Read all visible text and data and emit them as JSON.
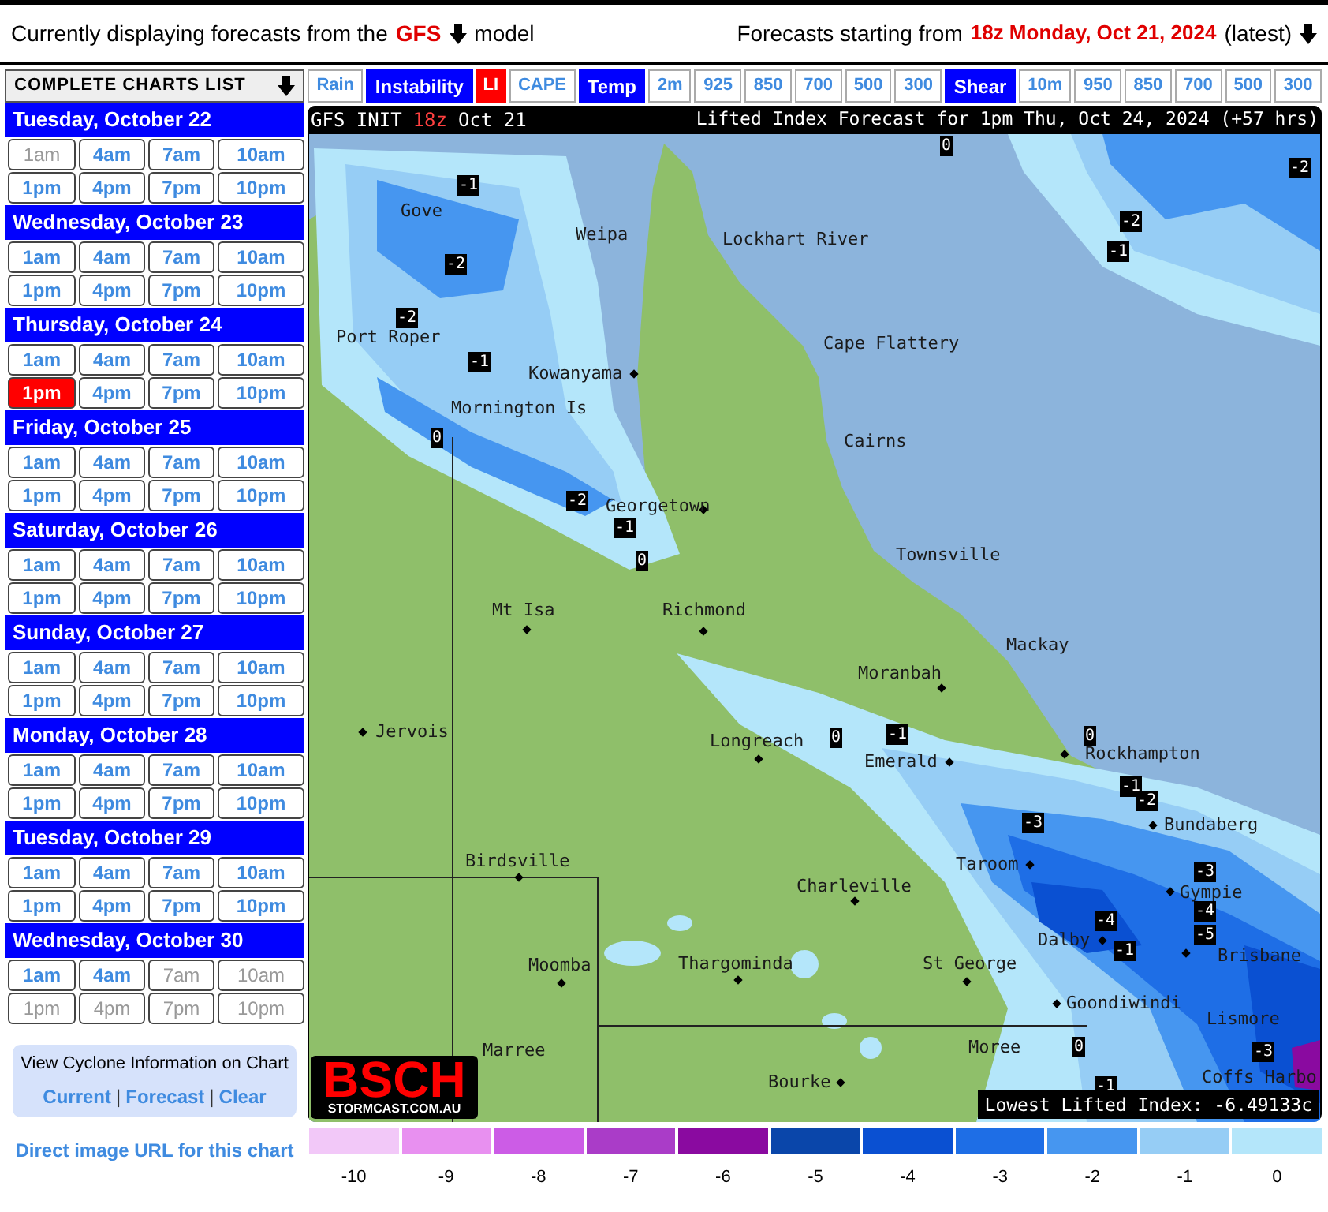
{
  "header": {
    "model_prefix": "Currently displaying forecasts from the",
    "model": "GFS",
    "model_suffix": "model",
    "run_prefix": "Forecasts starting from",
    "run": "18z Monday, Oct 21, 2024",
    "run_suffix": "(latest)"
  },
  "sidebar": {
    "title": "COMPLETE CHARTS LIST",
    "days": [
      {
        "label": "Tuesday, October 22",
        "times": [
          {
            "label": "1am",
            "selected": false,
            "disabled": true
          },
          {
            "label": "4am",
            "selected": false,
            "disabled": false
          },
          {
            "label": "7am",
            "selected": false,
            "disabled": false
          },
          {
            "label": "10am",
            "selected": false,
            "disabled": false
          },
          {
            "label": "1pm",
            "selected": false,
            "disabled": false
          },
          {
            "label": "4pm",
            "selected": false,
            "disabled": false
          },
          {
            "label": "7pm",
            "selected": false,
            "disabled": false
          },
          {
            "label": "10pm",
            "selected": false,
            "disabled": false
          }
        ]
      },
      {
        "label": "Wednesday, October 23",
        "times": [
          {
            "label": "1am",
            "selected": false,
            "disabled": false
          },
          {
            "label": "4am",
            "selected": false,
            "disabled": false
          },
          {
            "label": "7am",
            "selected": false,
            "disabled": false
          },
          {
            "label": "10am",
            "selected": false,
            "disabled": false
          },
          {
            "label": "1pm",
            "selected": false,
            "disabled": false
          },
          {
            "label": "4pm",
            "selected": false,
            "disabled": false
          },
          {
            "label": "7pm",
            "selected": false,
            "disabled": false
          },
          {
            "label": "10pm",
            "selected": false,
            "disabled": false
          }
        ]
      },
      {
        "label": "Thursday, October 24",
        "times": [
          {
            "label": "1am",
            "selected": false,
            "disabled": false
          },
          {
            "label": "4am",
            "selected": false,
            "disabled": false
          },
          {
            "label": "7am",
            "selected": false,
            "disabled": false
          },
          {
            "label": "10am",
            "selected": false,
            "disabled": false
          },
          {
            "label": "1pm",
            "selected": true,
            "disabled": false
          },
          {
            "label": "4pm",
            "selected": false,
            "disabled": false
          },
          {
            "label": "7pm",
            "selected": false,
            "disabled": false
          },
          {
            "label": "10pm",
            "selected": false,
            "disabled": false
          }
        ]
      },
      {
        "label": "Friday, October 25",
        "times": [
          {
            "label": "1am",
            "selected": false,
            "disabled": false
          },
          {
            "label": "4am",
            "selected": false,
            "disabled": false
          },
          {
            "label": "7am",
            "selected": false,
            "disabled": false
          },
          {
            "label": "10am",
            "selected": false,
            "disabled": false
          },
          {
            "label": "1pm",
            "selected": false,
            "disabled": false
          },
          {
            "label": "4pm",
            "selected": false,
            "disabled": false
          },
          {
            "label": "7pm",
            "selected": false,
            "disabled": false
          },
          {
            "label": "10pm",
            "selected": false,
            "disabled": false
          }
        ]
      },
      {
        "label": "Saturday, October 26",
        "times": [
          {
            "label": "1am",
            "selected": false,
            "disabled": false
          },
          {
            "label": "4am",
            "selected": false,
            "disabled": false
          },
          {
            "label": "7am",
            "selected": false,
            "disabled": false
          },
          {
            "label": "10am",
            "selected": false,
            "disabled": false
          },
          {
            "label": "1pm",
            "selected": false,
            "disabled": false
          },
          {
            "label": "4pm",
            "selected": false,
            "disabled": false
          },
          {
            "label": "7pm",
            "selected": false,
            "disabled": false
          },
          {
            "label": "10pm",
            "selected": false,
            "disabled": false
          }
        ]
      },
      {
        "label": "Sunday, October 27",
        "times": [
          {
            "label": "1am",
            "selected": false,
            "disabled": false
          },
          {
            "label": "4am",
            "selected": false,
            "disabled": false
          },
          {
            "label": "7am",
            "selected": false,
            "disabled": false
          },
          {
            "label": "10am",
            "selected": false,
            "disabled": false
          },
          {
            "label": "1pm",
            "selected": false,
            "disabled": false
          },
          {
            "label": "4pm",
            "selected": false,
            "disabled": false
          },
          {
            "label": "7pm",
            "selected": false,
            "disabled": false
          },
          {
            "label": "10pm",
            "selected": false,
            "disabled": false
          }
        ]
      },
      {
        "label": "Monday, October 28",
        "times": [
          {
            "label": "1am",
            "selected": false,
            "disabled": false
          },
          {
            "label": "4am",
            "selected": false,
            "disabled": false
          },
          {
            "label": "7am",
            "selected": false,
            "disabled": false
          },
          {
            "label": "10am",
            "selected": false,
            "disabled": false
          },
          {
            "label": "1pm",
            "selected": false,
            "disabled": false
          },
          {
            "label": "4pm",
            "selected": false,
            "disabled": false
          },
          {
            "label": "7pm",
            "selected": false,
            "disabled": false
          },
          {
            "label": "10pm",
            "selected": false,
            "disabled": false
          }
        ]
      },
      {
        "label": "Tuesday, October 29",
        "times": [
          {
            "label": "1am",
            "selected": false,
            "disabled": false
          },
          {
            "label": "4am",
            "selected": false,
            "disabled": false
          },
          {
            "label": "7am",
            "selected": false,
            "disabled": false
          },
          {
            "label": "10am",
            "selected": false,
            "disabled": false
          },
          {
            "label": "1pm",
            "selected": false,
            "disabled": false
          },
          {
            "label": "4pm",
            "selected": false,
            "disabled": false
          },
          {
            "label": "7pm",
            "selected": false,
            "disabled": false
          },
          {
            "label": "10pm",
            "selected": false,
            "disabled": false
          }
        ]
      },
      {
        "label": "Wednesday, October 30",
        "times": [
          {
            "label": "1am",
            "selected": false,
            "disabled": false
          },
          {
            "label": "4am",
            "selected": false,
            "disabled": false
          },
          {
            "label": "7am",
            "selected": false,
            "disabled": true
          },
          {
            "label": "10am",
            "selected": false,
            "disabled": true
          },
          {
            "label": "1pm",
            "selected": false,
            "disabled": true
          },
          {
            "label": "4pm",
            "selected": false,
            "disabled": true
          },
          {
            "label": "7pm",
            "selected": false,
            "disabled": true
          },
          {
            "label": "10pm",
            "selected": false,
            "disabled": true
          }
        ]
      }
    ],
    "cyclone": {
      "title": "View Cyclone Information on Chart",
      "links": [
        {
          "kind": "link",
          "label": "Current"
        },
        {
          "kind": "separator",
          "label": "|"
        },
        {
          "kind": "link",
          "label": "Forecast"
        },
        {
          "kind": "separator",
          "label": "|"
        },
        {
          "kind": "link",
          "label": "Clear"
        }
      ]
    },
    "direct_link": "Direct image URL for this chart"
  },
  "chart_tabs": [
    {
      "label": "Rain",
      "kind": "option",
      "selected": false
    },
    {
      "label": "Instability",
      "kind": "group"
    },
    {
      "label": "LI",
      "kind": "option",
      "selected": true
    },
    {
      "label": "CAPE",
      "kind": "option",
      "selected": false
    },
    {
      "label": "Temp",
      "kind": "group"
    },
    {
      "label": "2m",
      "kind": "option",
      "selected": false
    },
    {
      "label": "925",
      "kind": "option",
      "selected": false
    },
    {
      "label": "850",
      "kind": "option",
      "selected": false
    },
    {
      "label": "700",
      "kind": "option",
      "selected": false
    },
    {
      "label": "500",
      "kind": "option",
      "selected": false
    },
    {
      "label": "300",
      "kind": "option",
      "selected": false
    },
    {
      "label": "Shear",
      "kind": "group"
    },
    {
      "label": "10m",
      "kind": "option",
      "selected": false
    },
    {
      "label": "950",
      "kind": "option",
      "selected": false
    },
    {
      "label": "850",
      "kind": "option",
      "selected": false
    },
    {
      "label": "700",
      "kind": "option",
      "selected": false
    },
    {
      "label": "500",
      "kind": "option",
      "selected": false
    },
    {
      "label": "300",
      "kind": "option",
      "selected": false
    }
  ],
  "chart": {
    "init_label": "GFS INIT",
    "init_run": "18z",
    "init_date": "Oct 21",
    "title": "Lifted Index Forecast for 1pm Thu, Oct 24, 2024 (+57 hrs)",
    "places": [
      "Gove",
      "Weipa",
      "Lockhart River",
      "Port Roper",
      "Cape Flattery",
      "Kowanyama",
      "Mornington Is",
      "Cairns",
      "Georgetown",
      "Townsville",
      "Mt Isa",
      "Richmond",
      "Mackay",
      "Moranbah",
      "Jervois",
      "Longreach",
      "Emerald",
      "Rockhampton",
      "Bundaberg",
      "Birdsville",
      "Taroom",
      "Charleville",
      "Gympie",
      "Dalby",
      "Moomba",
      "Thargominda",
      "St George",
      "Brisbane",
      "Goondiwindi",
      "Lismore",
      "Marree",
      "Moree",
      "Bourke",
      "Coffs Harbo"
    ],
    "contour_labels": [
      "0",
      "-2",
      "-1",
      "-2",
      "-1",
      "-2",
      "-2",
      "-1",
      "0",
      "-2",
      "-1",
      "0",
      "0",
      "-1",
      "0",
      "-1",
      "-3",
      "-2",
      "-3",
      "-4",
      "-4",
      "-5",
      "-1",
      "-3",
      "0",
      "-1"
    ],
    "logo": "BSCH",
    "logo_site": "STORMCAST.COM.AU",
    "lowest": "Lowest Lifted Index: -6.49133c"
  },
  "legend": [
    {
      "label": "-10",
      "color": "#f2c8f8"
    },
    {
      "label": "-9",
      "color": "#e890f0"
    },
    {
      "label": "-8",
      "color": "#cc5ce6"
    },
    {
      "label": "-7",
      "color": "#aa3cc8"
    },
    {
      "label": "-6",
      "color": "#8a0aa0"
    },
    {
      "label": "-5",
      "color": "#0a46aa"
    },
    {
      "label": "-4",
      "color": "#0a50d2"
    },
    {
      "label": "-3",
      "color": "#1e6ee6"
    },
    {
      "label": "-2",
      "color": "#4696f0"
    },
    {
      "label": "-1",
      "color": "#96cdf5"
    },
    {
      "label": "0",
      "color": "#b4e6fa"
    }
  ]
}
